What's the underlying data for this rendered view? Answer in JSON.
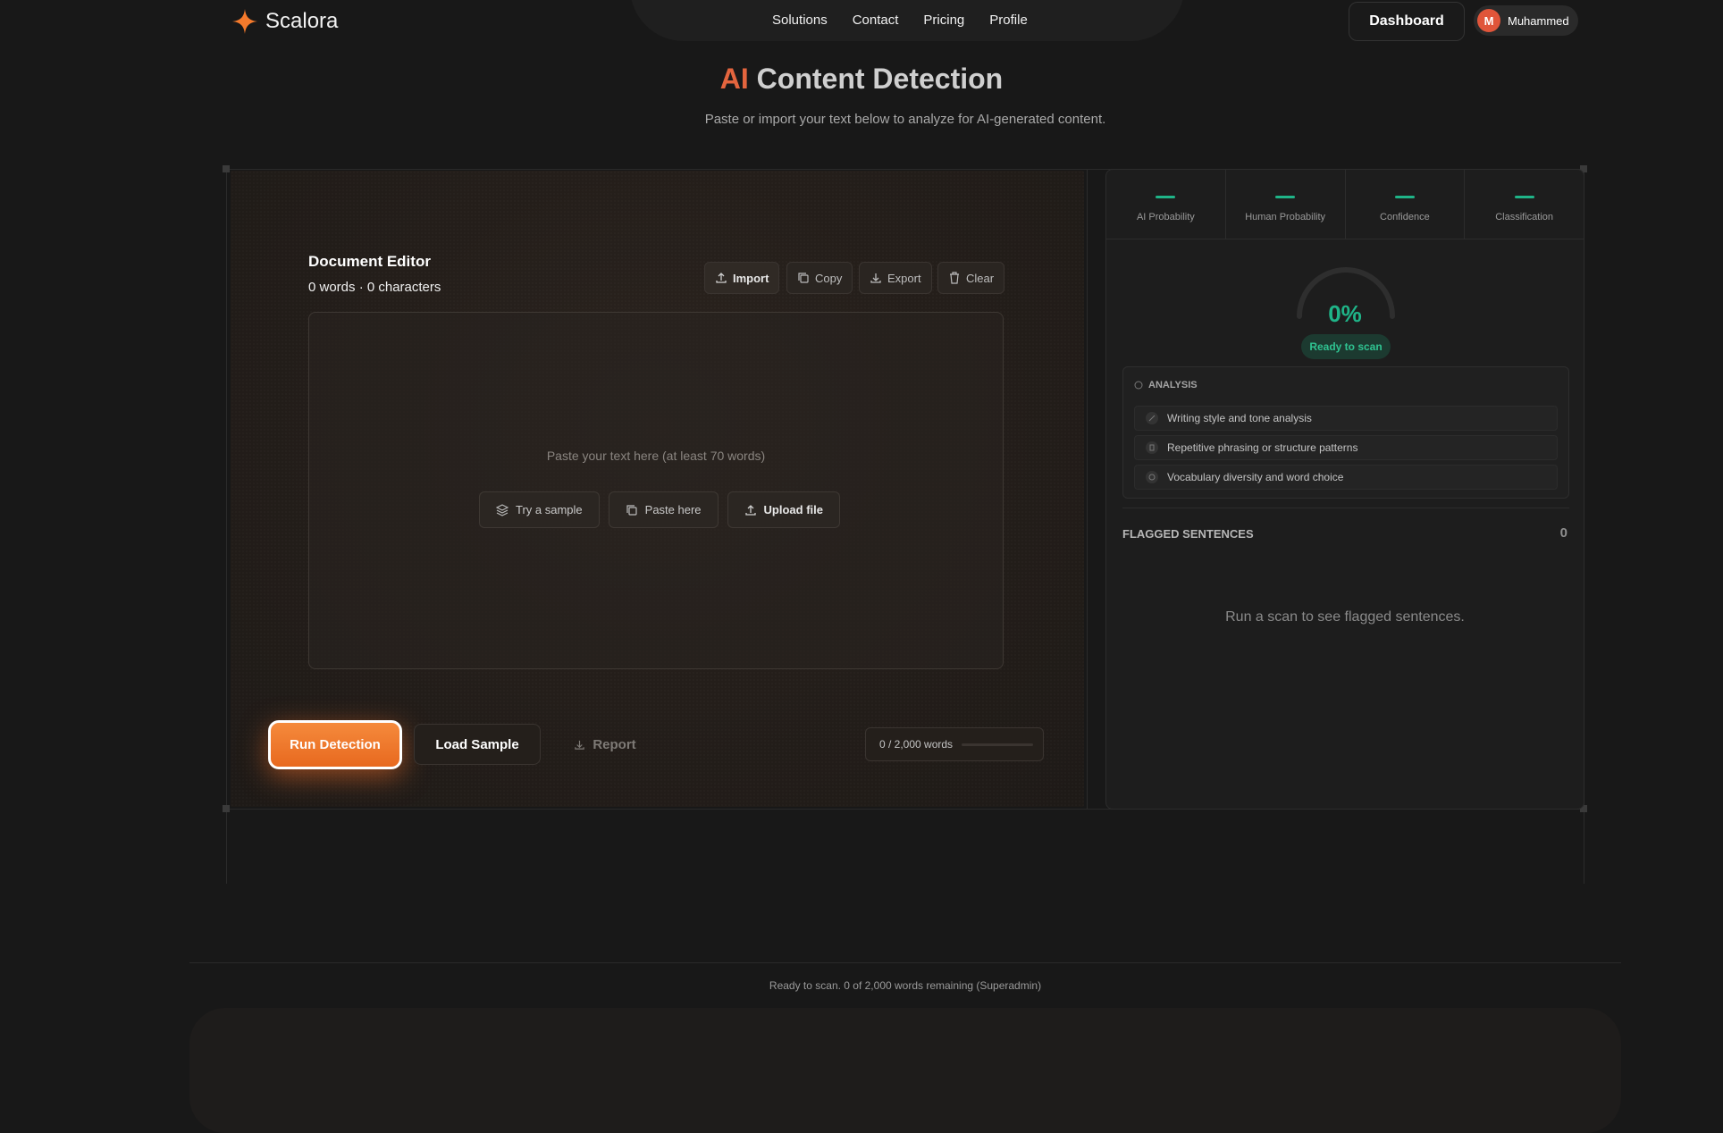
{
  "nav": {
    "brand": "Scalora",
    "links": [
      "Solutions",
      "Contact",
      "Pricing",
      "Profile"
    ],
    "dashboard_label": "Dashboard",
    "user": {
      "initial": "M",
      "name": "Muhammed"
    },
    "accent": "#f47a2c"
  },
  "hero": {
    "title_accent": "AI",
    "title_rest": "Content Detection",
    "subtitle": "Paste or import your text below to analyze for AI-generated content."
  },
  "editor": {
    "title": "Document Editor",
    "counts": "0 words · 0 characters",
    "toolbar": {
      "import": "Import",
      "copy": "Copy",
      "export": "Export",
      "clear": "Clear"
    },
    "placeholder": "Paste your text here (at least 70 words)",
    "actions": {
      "sample": "Try a sample",
      "paste": "Paste here",
      "upload": "Upload file"
    },
    "run_label": "Run Detection",
    "load_label": "Load Sample",
    "report_label": "Report",
    "word_limit_text": "0 / 2,000 words",
    "word_usage_fraction": 0
  },
  "results": {
    "metrics": [
      {
        "value": "—",
        "label": "AI Probability"
      },
      {
        "value": "—",
        "label": "Human Probability"
      },
      {
        "value": "—",
        "label": "Confidence"
      },
      {
        "value": "—",
        "label": "Classification"
      }
    ],
    "score": "0%",
    "score_fraction": 0,
    "status_pill": "Ready to scan",
    "status_color": "#1fb488",
    "analysis": {
      "heading": "ANALYSIS",
      "items": [
        "Writing style and tone analysis",
        "Repetitive phrasing or structure patterns",
        "Vocabulary diversity and word choice"
      ]
    },
    "flagged": {
      "title": "FLAGGED SENTENCES",
      "count": "0",
      "empty_text": "Run a scan to see flagged sentences."
    }
  },
  "footer": {
    "status": "Ready to scan. 0 of 2,000 words remaining (Superadmin)"
  }
}
